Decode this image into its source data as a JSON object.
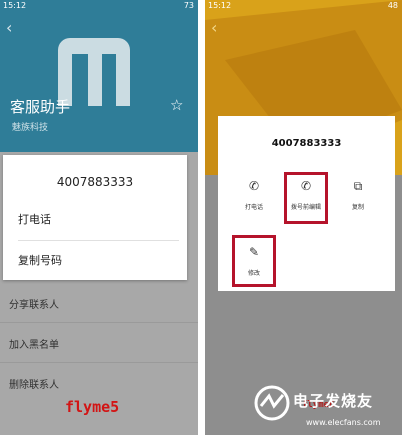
{
  "left": {
    "status_time": "15:12",
    "status_battery": "73",
    "contact_name": "客服助手",
    "contact_sub": "魅族科技",
    "dialog": {
      "number": "4007883333",
      "options": [
        "打电话",
        "复制号码"
      ]
    },
    "rows": [
      "分享联系人",
      "加入黑名单",
      "删除联系人"
    ],
    "caption": "flyme5"
  },
  "right": {
    "status_time": "15:12",
    "status_battery": "48",
    "dialog": {
      "number": "4007883333",
      "actions": [
        {
          "label": "打电话",
          "icon": "phone-icon"
        },
        {
          "label": "拨号前编辑",
          "icon": "phone-edit-icon"
        },
        {
          "label": "复制",
          "icon": "copy-icon"
        },
        {
          "label": "修改",
          "icon": "edit-icon"
        }
      ]
    },
    "caption": "flyme6"
  },
  "watermark": {
    "text": "电子发烧友",
    "url": "www.elecfans.com"
  }
}
